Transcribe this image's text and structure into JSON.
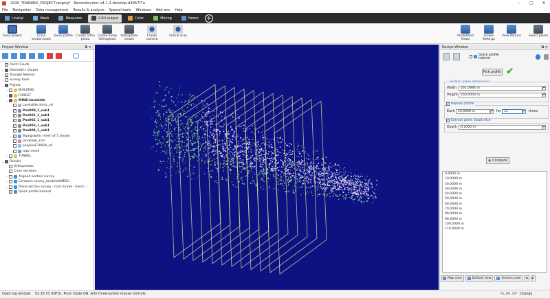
{
  "window": {
    "title": "2020_TRAINING_PROJECT.recproj* - Reconstructor v4.1.2-develop-d3957f7a"
  },
  "menu": [
    "File",
    "Navigation",
    "Data management",
    "Results & analysis",
    "Special tools",
    "Windows",
    "Add-ons",
    "Help"
  ],
  "tabs": [
    {
      "label": "LineUp",
      "color": "#5aa0e0"
    },
    {
      "label": "Mesh",
      "color": "#6fb0e8"
    },
    {
      "label": "Measures",
      "color": "#8aa0c8"
    },
    {
      "label": "CAD output",
      "color": "#404040",
      "active": true
    },
    {
      "label": "Color",
      "color": "#e0a040"
    },
    {
      "label": "Mining",
      "color": "#7fbf5f"
    },
    {
      "label": "Heron",
      "color": "#5f8fd0"
    }
  ],
  "ribbon": {
    "save": "Save project",
    "cross": "Cross section tools",
    "quick": "Quick profile",
    "ortho": "Create ortho photo",
    "xray": "Create X-Ray Orthophoto",
    "viewer": "Orthophoto viewer",
    "camera": "Create camera",
    "vscan": "Virtual scan",
    "views": "Predefined Views",
    "screen": "Screen Settings",
    "params": "View Params",
    "sel": "Select points"
  },
  "project_window": {
    "title": "Project Window",
    "tree": [
      {
        "label": "Point Clouds",
        "d": 0,
        "arr": "",
        "cb": "on"
      },
      {
        "label": "Geometric shapes",
        "d": 0,
        "arr": "›",
        "cb": "part"
      },
      {
        "label": "Triangle Meshes",
        "d": 0,
        "arr": "›",
        "cb": "on"
      },
      {
        "label": "Survey tools",
        "d": 0,
        "arr": "›",
        "cb": "off"
      },
      {
        "label": "Project",
        "d": 0,
        "arr": "⌄",
        "cb": "part"
      },
      {
        "label": "BUILDING",
        "d": 1,
        "arr": "›",
        "cb": "off",
        "ic": "#e8c050"
      },
      {
        "label": "FOREST",
        "d": 1,
        "arr": "›",
        "cb": "part",
        "ic": "#e8c050"
      },
      {
        "label": "MINE-landslide",
        "d": 1,
        "arr": "⌄",
        "cb": "part",
        "ic": "#e8c050",
        "b": true
      },
      {
        "label": "Landslide limits_v0",
        "d": 2,
        "arr": "",
        "cb": "off",
        "ic": "#9bb7d4"
      },
      {
        "label": "Pos000_1_sub1",
        "d": 2,
        "arr": "",
        "cb": "on",
        "ic": "#888",
        "b": true
      },
      {
        "label": "Pos001_1_sub1",
        "d": 2,
        "arr": "",
        "cb": "on",
        "ic": "#888",
        "b": true
      },
      {
        "label": "Pos002_1_sub1",
        "d": 2,
        "arr": "",
        "cb": "on",
        "ic": "#888",
        "b": true
      },
      {
        "label": "Pos003_1_sub1",
        "d": 2,
        "arr": "",
        "cb": "on",
        "ic": "#888",
        "b": true
      },
      {
        "label": "Pos004_1_sub1",
        "d": 2,
        "arr": "",
        "cb": "on",
        "ic": "#888",
        "b": true
      },
      {
        "label": "Topographic mesh of 5 clouds",
        "d": 2,
        "arr": "›",
        "cb": "on",
        "ic": "#5aa0e0"
      },
      {
        "label": "landslide_2cm",
        "d": 2,
        "arr": "",
        "cb": "off",
        "ic": "#d080c0"
      },
      {
        "label": "polylineF10020_v0",
        "d": 2,
        "arr": "",
        "cb": "off",
        "ic": "#9bb7d4"
      },
      {
        "label": "topo mesh",
        "d": 2,
        "arr": "",
        "cb": "off",
        "ic": "#5aa0e0"
      },
      {
        "label": "TUNNEL",
        "d": 1,
        "arr": "›",
        "cb": "off",
        "ic": "#e8c050"
      },
      {
        "label": "Results",
        "d": 0,
        "arr": "⌄",
        "cb": "part"
      },
      {
        "label": "Orthophotos",
        "d": 1,
        "arr": "",
        "cb": "off"
      },
      {
        "label": "Cross sections",
        "d": 1,
        "arr": "",
        "cb": "off"
      },
      {
        "label": "Aligned section survey",
        "d": 1,
        "arr": "›",
        "cb": "off",
        "ic": "#3a8fd8"
      },
      {
        "label": "Contours survey_landslideMESH",
        "d": 1,
        "arr": "›",
        "cb": "off",
        "ic": "#3a8fd8"
      },
      {
        "label": "Plane section survey - rock tunnel - heron ...",
        "d": 1,
        "arr": "›",
        "cb": "off",
        "ic": "#3a8fd8"
      },
      {
        "label": "Quick profile tutorial",
        "d": 1,
        "arr": "",
        "cb": "on",
        "ic": "#3a8fd8"
      }
    ]
  },
  "recipe": {
    "title": "Recipe Window",
    "name": "Quick profile tutorial",
    "pick": "Pick profile",
    "dims_title": "Section plane dimensions",
    "width_lbl": "Width",
    "width_val": "261,0984 m",
    "height_lbl": "Height",
    "height_val": "160,0000 m",
    "repeat_lbl": "Repeat profile",
    "each_lbl": "Each",
    "each_val": "10,0000 m",
    "for_lbl": "for",
    "for_val": "12",
    "times_lbl": "times",
    "extract_lbl": "Extract point cloud slice",
    "depth_lbl": "Depth",
    "depth_val": "0,1000 m",
    "compute": "Compute",
    "list": [
      "0,0000 m",
      "10,0000 m",
      "20,0000 m",
      "30,0000 m",
      "40,0000 m",
      "50,0000 m",
      "60,0000 m",
      "70,0000 m",
      "80,0000 m",
      "90,0000 m",
      "100,0000 m",
      "110,0000 m"
    ],
    "map_view": "Map view",
    "default_view": "Default view",
    "section_view": "Section view"
  },
  "status": {
    "log": "Open log window",
    "msg": "02:26:53 (INFO): Pivot mode ON, with three-button mouse controls.",
    "units": "m, m², m³",
    "change": "Change"
  },
  "colors": {
    "viewport": "#0c1282",
    "planes": "#d4cf90",
    "accent": "#3267b0",
    "check": "#2e9e2e"
  }
}
